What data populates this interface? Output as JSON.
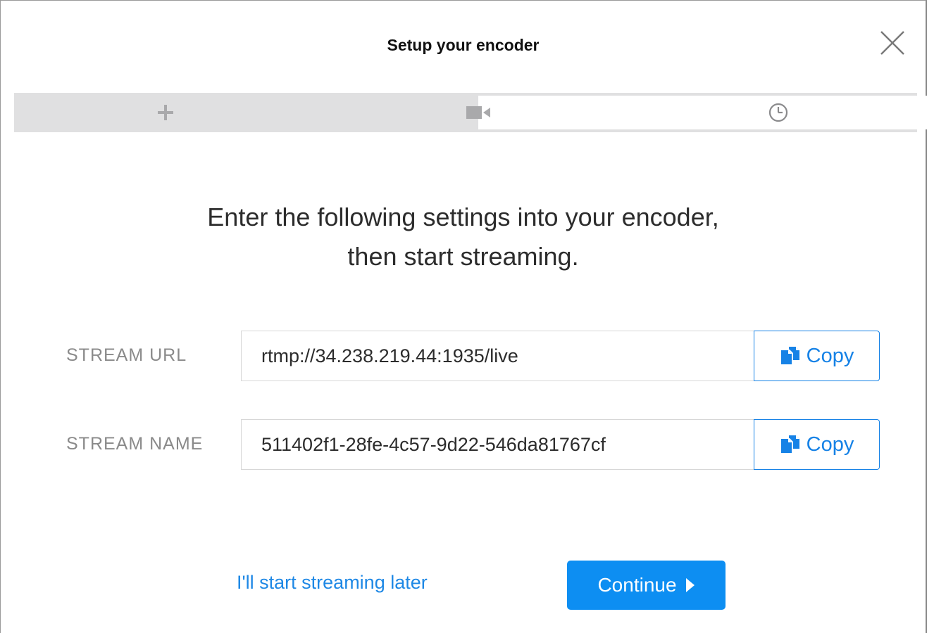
{
  "dialog": {
    "title": "Setup your encoder",
    "close_icon": "close-icon"
  },
  "progress": {
    "steps": [
      {
        "icon": "plus-icon",
        "state": "complete"
      },
      {
        "icon": "video-camera-icon",
        "state": "current"
      },
      {
        "icon": "clock-icon",
        "state": "upcoming"
      }
    ],
    "fill_color": "#e0e0e1"
  },
  "instructions": {
    "line1": "Enter the following settings into your encoder,",
    "line2": "then start streaming."
  },
  "fields": {
    "stream_url": {
      "label": "STREAM URL",
      "value": "rtmp://34.238.219.44:1935/live",
      "copy_label": "Copy",
      "copy_icon": "copy-icon"
    },
    "stream_name": {
      "label": "STREAM NAME",
      "value": "511402f1-28fe-4c57-9d22-546da81767cf",
      "copy_label": "Copy",
      "copy_icon": "copy-icon"
    }
  },
  "footer": {
    "later_link": "I'll start streaming later",
    "continue_label": "Continue",
    "continue_icon": "caret-right-icon"
  },
  "colors": {
    "accent": "#1682e6",
    "primary_button": "#0d8ef2",
    "label_gray": "#8a8a8a"
  }
}
